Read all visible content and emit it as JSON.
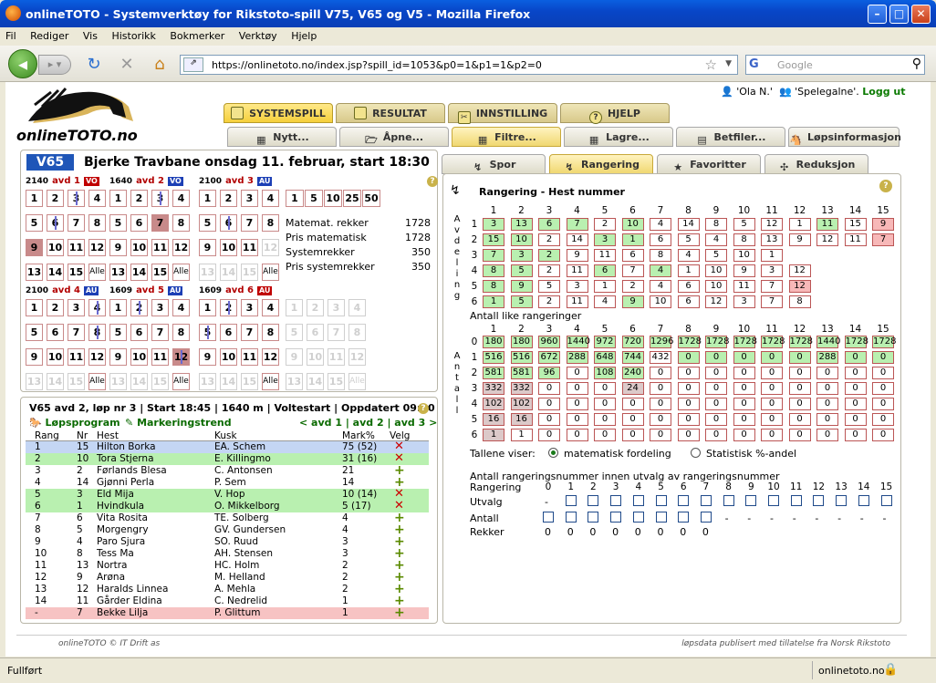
{
  "window": {
    "title": "onlineTOTO - Systemverktøy for Rikstoto-spill V75, V65 og V5 - Mozilla Firefox"
  },
  "menu": [
    "Fil",
    "Rediger",
    "Vis",
    "Historikk",
    "Bokmerker",
    "Verktøy",
    "Hjelp"
  ],
  "url": "https://onlinetoto.no/index.jsp?spill_id=1053&p0=1&p1=1&p2=0",
  "search_placeholder": "Google",
  "logo": {
    "a": "online",
    "b": "TOTO",
    ".no": ".no"
  },
  "user": {
    "name": "'Ola N.'",
    "group": "'Spelegalne'.",
    "logout": "Logg ut"
  },
  "maintabs": [
    "SYSTEMSPILL",
    "RESULTAT",
    "INNSTILLING",
    "HJELP"
  ],
  "subtabs": [
    "Nytt...",
    "Åpne...",
    "Filtre...",
    "Lagre...",
    "Betfiler...",
    "Løpsinformasjon"
  ],
  "rtabs": [
    "Spor",
    "Rangering",
    "Favoritter",
    "Reduksjon"
  ],
  "game": {
    "badge": "V65",
    "title": "Bjerke Travbane onsdag 11. februar, start 18:30"
  },
  "avd": [
    {
      "dist": "2140",
      "name": "avd 1",
      "tag": "VO",
      "tagcolor": "#c00000"
    },
    {
      "dist": "1640",
      "name": "avd 2",
      "tag": "VO",
      "tagcolor": "#1c3fb5"
    },
    {
      "dist": "2100",
      "name": "avd 3",
      "tag": "AU",
      "tagcolor": "#1c3fb5"
    },
    {
      "dist": "2100",
      "name": "avd 4",
      "tag": "AU",
      "tagcolor": "#1c3fb5"
    },
    {
      "dist": "1609",
      "name": "avd 5",
      "tag": "AU",
      "tagcolor": "#1c3fb5"
    },
    {
      "dist": "1609",
      "name": "avd 6",
      "tag": "AU",
      "tagcolor": "#c00000"
    }
  ],
  "alle": "Alle",
  "bet_amounts": [
    "1",
    "5",
    "10",
    "25",
    "50"
  ],
  "stats": [
    {
      "label": "Matemat. rekker",
      "value": "1728"
    },
    {
      "label": "Pris matematisk",
      "value": "1728"
    },
    {
      "label": "Systemrekker",
      "value": "350"
    },
    {
      "label": "Pris systemrekker",
      "value": "350"
    }
  ],
  "raceinfo": "V65 avd 2, løp nr 3  |  Start 18:45 | 1640 m | Voltestart | Oppdatert 09:00",
  "lopsprogram": "Løpsprogram",
  "markeringstrend": "Markeringstrend",
  "avdnav": "< avd 1 | avd 2 | avd 3 >",
  "horse_headers": [
    "Rang",
    "Nr",
    "Hest",
    "Kusk",
    "Mark%",
    "Velg"
  ],
  "horses": [
    [
      "1",
      "15",
      "Hilton Borka",
      "EA. Schem",
      "75 (52)",
      "x",
      "b"
    ],
    [
      "2",
      "10",
      "Tora Stjerna",
      "E. Killingmo",
      "31 (16)",
      "x",
      "g"
    ],
    [
      "3",
      "2",
      "Førlands Blesa",
      "C. Antonsen",
      "21",
      "+",
      ""
    ],
    [
      "4",
      "14",
      "Gjønni Perla",
      "P. Sem",
      "14",
      "+",
      ""
    ],
    [
      "5",
      "3",
      "Eld Mija",
      "V. Hop",
      "10 (14)",
      "x",
      "g"
    ],
    [
      "6",
      "1",
      "Hvindkula",
      "O. Mikkelborg",
      "5 (17)",
      "x",
      "g"
    ],
    [
      "7",
      "6",
      "Vita Rosita",
      "TE. Solberg",
      "4",
      "+",
      ""
    ],
    [
      "8",
      "5",
      "Morgengry",
      "GV. Gundersen",
      "4",
      "+",
      ""
    ],
    [
      "9",
      "4",
      "Paro Sjura",
      "SO. Ruud",
      "3",
      "+",
      ""
    ],
    [
      "10",
      "8",
      "Tess Ma",
      "AH. Stensen",
      "3",
      "+",
      ""
    ],
    [
      "11",
      "13",
      "Nortra",
      "HC. Holm",
      "2",
      "+",
      ""
    ],
    [
      "12",
      "9",
      "Arøna",
      "M. Helland",
      "2",
      "+",
      ""
    ],
    [
      "13",
      "12",
      "Haralds Linnea",
      "A. Mehla",
      "2",
      "+",
      ""
    ],
    [
      "14",
      "11",
      "Gårder Eldina",
      "C. Nedrelid",
      "1",
      "+",
      ""
    ],
    [
      "-",
      "7",
      "Bekke Lilja",
      "P. Glittum",
      "1",
      "+",
      "r"
    ]
  ],
  "rangering": {
    "title": "Rangering - Hest nummer",
    "vlabel": "Avdeling",
    "cols": [
      "1",
      "2",
      "3",
      "4",
      "5",
      "6",
      "7",
      "8",
      "9",
      "10",
      "11",
      "12",
      "13",
      "14",
      "15"
    ],
    "rows": [
      [
        [
          "3",
          "g"
        ],
        [
          "13",
          "g"
        ],
        [
          "6",
          "g"
        ],
        [
          "7",
          "g"
        ],
        [
          "2",
          ""
        ],
        [
          "10",
          "g"
        ],
        [
          "4",
          ""
        ],
        [
          "14",
          ""
        ],
        [
          "8",
          ""
        ],
        [
          "5",
          ""
        ],
        [
          "12",
          ""
        ],
        [
          "1",
          ""
        ],
        [
          "11",
          "g"
        ],
        [
          "15",
          ""
        ],
        [
          "9",
          "r"
        ]
      ],
      [
        [
          "15",
          "g"
        ],
        [
          "10",
          "g"
        ],
        [
          "2",
          ""
        ],
        [
          "14",
          ""
        ],
        [
          "3",
          "g"
        ],
        [
          "1",
          "g"
        ],
        [
          "6",
          ""
        ],
        [
          "5",
          ""
        ],
        [
          "4",
          ""
        ],
        [
          "8",
          ""
        ],
        [
          "13",
          ""
        ],
        [
          "9",
          ""
        ],
        [
          "12",
          ""
        ],
        [
          "11",
          ""
        ],
        [
          "7",
          "r"
        ]
      ],
      [
        [
          "7",
          "g"
        ],
        [
          "3",
          "g"
        ],
        [
          "2",
          "g"
        ],
        [
          "9",
          ""
        ],
        [
          "11",
          ""
        ],
        [
          "6",
          ""
        ],
        [
          "8",
          ""
        ],
        [
          "4",
          ""
        ],
        [
          "5",
          ""
        ],
        [
          "10",
          ""
        ],
        [
          "1",
          ""
        ]
      ],
      [
        [
          "8",
          "g"
        ],
        [
          "5",
          "g"
        ],
        [
          "2",
          ""
        ],
        [
          "11",
          ""
        ],
        [
          "6",
          "g"
        ],
        [
          "7",
          ""
        ],
        [
          "4",
          "g"
        ],
        [
          "1",
          ""
        ],
        [
          "10",
          ""
        ],
        [
          "9",
          ""
        ],
        [
          "3",
          ""
        ],
        [
          "12",
          ""
        ]
      ],
      [
        [
          "8",
          "g"
        ],
        [
          "9",
          "g"
        ],
        [
          "5",
          ""
        ],
        [
          "3",
          ""
        ],
        [
          "1",
          ""
        ],
        [
          "2",
          ""
        ],
        [
          "4",
          ""
        ],
        [
          "6",
          ""
        ],
        [
          "10",
          ""
        ],
        [
          "11",
          ""
        ],
        [
          "7",
          ""
        ],
        [
          "12",
          "r"
        ]
      ],
      [
        [
          "1",
          "g"
        ],
        [
          "5",
          "g"
        ],
        [
          "2",
          ""
        ],
        [
          "11",
          ""
        ],
        [
          "4",
          ""
        ],
        [
          "9",
          "g"
        ],
        [
          "10",
          ""
        ],
        [
          "6",
          ""
        ],
        [
          "12",
          ""
        ],
        [
          "3",
          ""
        ],
        [
          "7",
          ""
        ],
        [
          "8",
          ""
        ]
      ]
    ],
    "like_title": "Antall like rangeringer",
    "like_vlabel": "Antall",
    "like_rows": [
      [
        [
          "180",
          "g"
        ],
        [
          "180",
          "g"
        ],
        [
          "960",
          "g"
        ],
        [
          "1440",
          "g"
        ],
        [
          "972",
          "g"
        ],
        [
          "720",
          "g"
        ],
        [
          "1296",
          "g"
        ],
        [
          "1728",
          "g"
        ],
        [
          "1728",
          "g"
        ],
        [
          "1728",
          "g"
        ],
        [
          "1728",
          "g"
        ],
        [
          "1728",
          "g"
        ],
        [
          "1440",
          "g"
        ],
        [
          "1728",
          "g"
        ],
        [
          "1728",
          "g"
        ]
      ],
      [
        [
          "516",
          "g"
        ],
        [
          "516",
          "g"
        ],
        [
          "672",
          "g"
        ],
        [
          "288",
          "g"
        ],
        [
          "648",
          "g"
        ],
        [
          "744",
          "g"
        ],
        [
          "432",
          ""
        ],
        [
          "0",
          "g"
        ],
        [
          "0",
          "g"
        ],
        [
          "0",
          "g"
        ],
        [
          "0",
          "g"
        ],
        [
          "0",
          "g"
        ],
        [
          "288",
          "g"
        ],
        [
          "0",
          "g"
        ],
        [
          "0",
          "g"
        ]
      ],
      [
        [
          "581",
          "g"
        ],
        [
          "581",
          "g"
        ],
        [
          "96",
          "g"
        ],
        [
          "0",
          ""
        ],
        [
          "108",
          "g"
        ],
        [
          "240",
          "g"
        ],
        [
          "0",
          ""
        ],
        [
          "0",
          ""
        ],
        [
          "0",
          ""
        ],
        [
          "0",
          ""
        ],
        [
          "0",
          ""
        ],
        [
          "0",
          ""
        ],
        [
          "0",
          ""
        ],
        [
          "0",
          ""
        ],
        [
          "0",
          ""
        ]
      ],
      [
        [
          "332",
          "d"
        ],
        [
          "332",
          "d"
        ],
        [
          "0",
          ""
        ],
        [
          "0",
          ""
        ],
        [
          "0",
          ""
        ],
        [
          "24",
          "d"
        ],
        [
          "0",
          ""
        ],
        [
          "0",
          ""
        ],
        [
          "0",
          ""
        ],
        [
          "0",
          ""
        ],
        [
          "0",
          ""
        ],
        [
          "0",
          ""
        ],
        [
          "0",
          ""
        ],
        [
          "0",
          ""
        ],
        [
          "0",
          ""
        ]
      ],
      [
        [
          "102",
          "d"
        ],
        [
          "102",
          "d"
        ],
        [
          "0",
          ""
        ],
        [
          "0",
          ""
        ],
        [
          "0",
          ""
        ],
        [
          "0",
          ""
        ],
        [
          "0",
          ""
        ],
        [
          "0",
          ""
        ],
        [
          "0",
          ""
        ],
        [
          "0",
          ""
        ],
        [
          "0",
          ""
        ],
        [
          "0",
          ""
        ],
        [
          "0",
          ""
        ],
        [
          "0",
          ""
        ],
        [
          "0",
          ""
        ]
      ],
      [
        [
          "16",
          "d"
        ],
        [
          "16",
          "d"
        ],
        [
          "0",
          ""
        ],
        [
          "0",
          ""
        ],
        [
          "0",
          ""
        ],
        [
          "0",
          ""
        ],
        [
          "0",
          ""
        ],
        [
          "0",
          ""
        ],
        [
          "0",
          ""
        ],
        [
          "0",
          ""
        ],
        [
          "0",
          ""
        ],
        [
          "0",
          ""
        ],
        [
          "0",
          ""
        ],
        [
          "0",
          ""
        ],
        [
          "0",
          ""
        ]
      ],
      [
        [
          "1",
          "d"
        ],
        [
          "1",
          ""
        ],
        [
          "0",
          ""
        ],
        [
          "0",
          ""
        ],
        [
          "0",
          ""
        ],
        [
          "0",
          ""
        ],
        [
          "0",
          ""
        ],
        [
          "0",
          ""
        ],
        [
          "0",
          ""
        ],
        [
          "0",
          ""
        ],
        [
          "0",
          ""
        ],
        [
          "0",
          ""
        ],
        [
          "0",
          ""
        ],
        [
          "0",
          ""
        ],
        [
          "0",
          ""
        ]
      ]
    ],
    "talene": "Tallene viser:",
    "opt1": "matematisk fordeling",
    "opt2": "Statistisk %-andel",
    "utvalg_title": "Antall rangeringsnummer innen utvalg av rangeringsnummer",
    "rangering_label": "Rangering",
    "utvalg_label": "Utvalg",
    "antall_label": "Antall",
    "rekker_label": "Rekker",
    "utvalg_cols": [
      "0",
      "1",
      "2",
      "3",
      "4",
      "5",
      "6",
      "7",
      "8",
      "9",
      "10",
      "11",
      "12",
      "13",
      "14",
      "15"
    ],
    "rekker_vals": [
      "0",
      "0",
      "0",
      "0",
      "0",
      "0",
      "0",
      "0"
    ]
  },
  "footer": {
    "left": "onlineTOTO © IT Drift as",
    "right": "løpsdata publisert med tillatelse fra Norsk Rikstoto"
  },
  "status": {
    "left": "Fullført",
    "right": "onlinetoto.no"
  }
}
